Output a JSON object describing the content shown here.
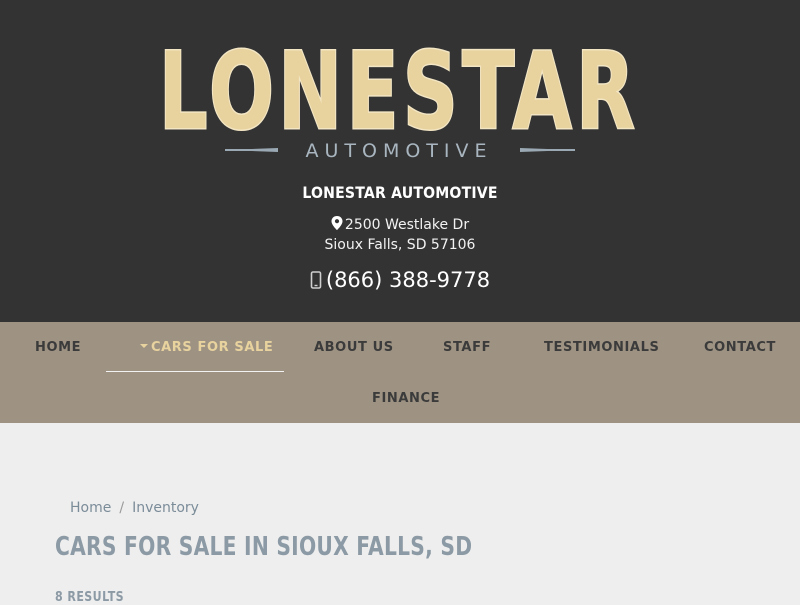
{
  "brand": {
    "logo_word": "LONESTAR",
    "logo_sub": "AUTOMOTIVE",
    "name": "LONESTAR AUTOMOTIVE",
    "address_line1": "2500 Westlake Dr",
    "address_line2": "Sioux Falls, SD 57106",
    "phone": "(866) 388-9778"
  },
  "nav": {
    "items": [
      {
        "label": "HOME"
      },
      {
        "label": "CARS FOR SALE",
        "active": true
      },
      {
        "label": "ABOUT US"
      },
      {
        "label": "STAFF"
      },
      {
        "label": "TESTIMONIALS"
      },
      {
        "label": "CONTACT"
      },
      {
        "label": "FINANCE"
      }
    ]
  },
  "breadcrumb": {
    "home": "Home",
    "separator": "/",
    "current": "Inventory"
  },
  "page": {
    "title": "CARS FOR SALE IN SIOUX FALLS, SD",
    "results": "8 RESULTS"
  },
  "colors": {
    "header_bg": "#333333",
    "nav_bg": "#9e9383",
    "accent_gold": "#e8d29e",
    "title_gray": "#8c9aa5"
  },
  "icons": {
    "address": "map-pin-icon",
    "phone": "mobile-phone-icon",
    "dropdown": "caret-down-icon"
  }
}
